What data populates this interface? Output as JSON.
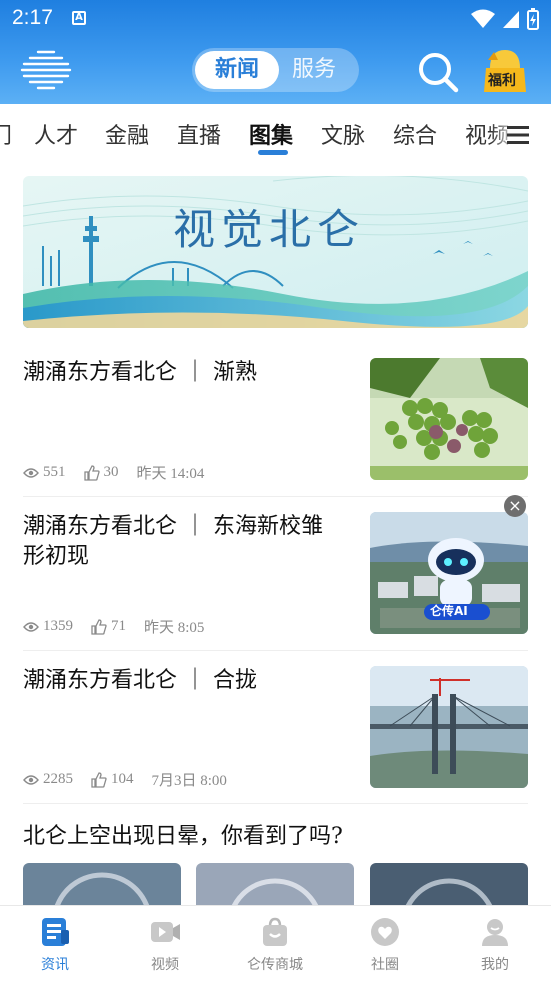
{
  "status_bar": {
    "time": "2:17",
    "notif_letter": "A"
  },
  "header": {
    "segments": [
      "新闻",
      "服务"
    ],
    "active_segment": "新闻",
    "welfare_label": "福利"
  },
  "tabs": {
    "items": [
      "门",
      "人才",
      "金融",
      "直播",
      "图集",
      "文脉",
      "综合",
      "视频"
    ],
    "active": "图集"
  },
  "banner": {
    "title": "视觉北仑"
  },
  "articles": [
    {
      "title": "潮涌东方看北仑 ｜ 渐熟",
      "views": "551",
      "likes": "30",
      "time": "昨天 14:04"
    },
    {
      "title": "潮涌东方看北仑 ｜ 东海新校雏形初现",
      "views": "1359",
      "likes": "71",
      "time": "昨天 8:05",
      "badge": "仑传AI"
    },
    {
      "title": "潮涌东方看北仑 ｜ 合拢",
      "views": "2285",
      "likes": "104",
      "time": "7月3日 8:00"
    }
  ],
  "gallery": {
    "title": "北仑上空出现日晕，你看到了吗?"
  },
  "bottom_nav": {
    "items": [
      "资讯",
      "视频",
      "仑传商城",
      "社圈",
      "我的"
    ],
    "active": "资讯"
  },
  "colors": {
    "accent": "#2a7fd8",
    "header_top": "#1f7fe0",
    "header_bottom": "#5cb0f5"
  }
}
